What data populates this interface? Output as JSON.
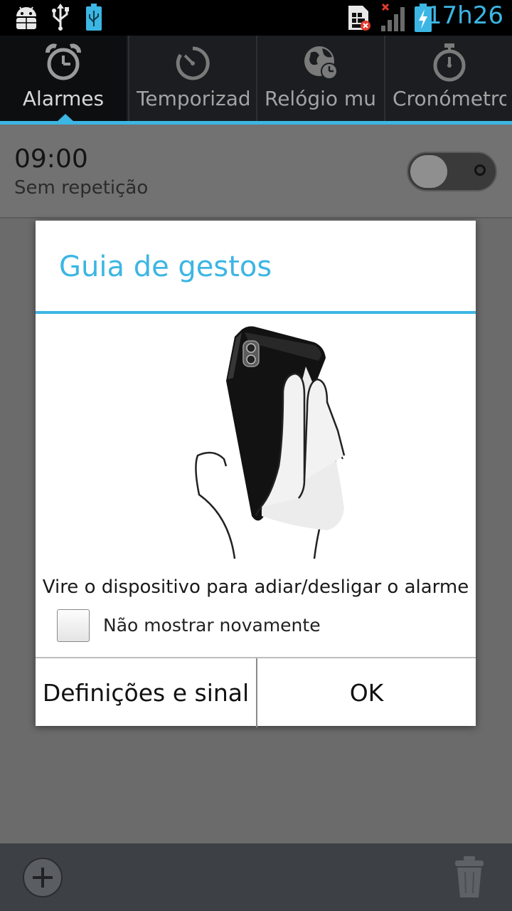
{
  "status_bar": {
    "time": "17h26",
    "icons": [
      "android-debug-icon",
      "usb-icon",
      "usb-battery-icon",
      "sim-error-icon",
      "signal-icon",
      "battery-charging-icon"
    ]
  },
  "tabs": [
    {
      "label": "Alarmes",
      "icon": "alarm-clock-icon",
      "selected": true
    },
    {
      "label": "Temporizador",
      "icon": "timer-icon",
      "selected": false
    },
    {
      "label": "Relógio mundial",
      "icon": "world-clock-icon",
      "selected": false
    },
    {
      "label": "Cronómetro",
      "icon": "stopwatch-icon",
      "selected": false
    }
  ],
  "alarm": {
    "time": "09:00",
    "repeat": "Sem repetição",
    "enabled": false
  },
  "dialog": {
    "title": "Guia de gestos",
    "illustration": "hand-flipping-phone",
    "message": "Vire o dispositivo para adiar/desligar o alarme",
    "checkbox_label": "Não mostrar novamente",
    "checkbox_checked": false,
    "buttons": {
      "settings": "Definições e sinal",
      "ok": "OK"
    }
  },
  "bottom_bar": {
    "add_icon": "add-icon",
    "delete_icon": "trash-icon"
  },
  "colors": {
    "accent": "#3cb6e3",
    "background": "#6b6b6b",
    "tabbar": "#1b1d20"
  }
}
